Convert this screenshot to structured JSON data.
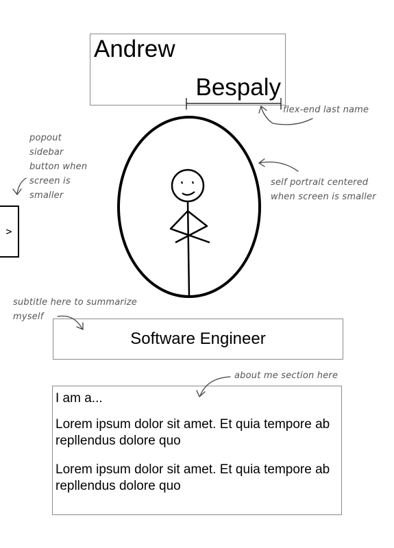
{
  "header": {
    "first_name": "Andrew",
    "last_name": "Bespaly"
  },
  "sidebar": {
    "toggle_label": ">"
  },
  "subtitle": "Software Engineer",
  "about": {
    "intro": "I am a...",
    "paragraphs": [
      "Lorem ipsum dolor sit amet. Et quia tempore ab repllendus dolore quo",
      "Lorem ipsum dolor sit amet. Et quia tempore ab repllendus dolore quo"
    ]
  },
  "annotations": {
    "sidebar_note": [
      "popout",
      "sidebar",
      "button when",
      "screen is",
      "smaller"
    ],
    "last_name_note": "flex-end last name",
    "portrait_note": [
      "self portrait centered",
      "when screen is smaller"
    ],
    "subtitle_note": [
      "subtitle here to summarize",
      "myself"
    ],
    "about_note": "about me section here"
  },
  "portrait": {
    "icon": "stick-figure-icon"
  }
}
